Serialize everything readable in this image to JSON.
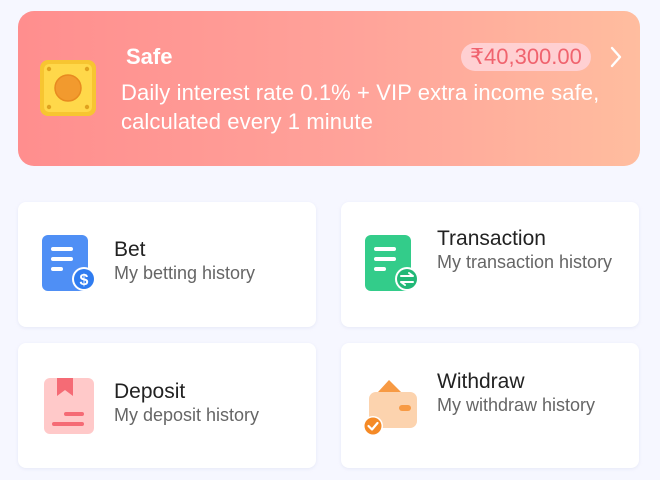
{
  "safe": {
    "title": "Safe",
    "amount": "₹40,300.00",
    "description": "Daily interest rate 0.1% + VIP extra income safe, calculated every 1 minute",
    "icon": "safe-box-icon",
    "colors": {
      "gradient_start": "#ff8e8e",
      "gradient_end": "#ffbd9f",
      "amount_text": "#f0636e",
      "amount_pill": "#ffd0d2"
    }
  },
  "tiles": [
    {
      "title": "Bet",
      "subtitle": "My betting history",
      "icon": "bet-history-icon",
      "color": "#4f8ff5"
    },
    {
      "title": "Transaction",
      "subtitle": "My transaction history",
      "icon": "transaction-history-icon",
      "color": "#33cc8a"
    },
    {
      "title": "Deposit",
      "subtitle": "My deposit history",
      "icon": "deposit-history-icon",
      "color": "#f77d86"
    },
    {
      "title": "Withdraw",
      "subtitle": "My withdraw history",
      "icon": "withdraw-history-icon",
      "color": "#f9a86b"
    }
  ]
}
